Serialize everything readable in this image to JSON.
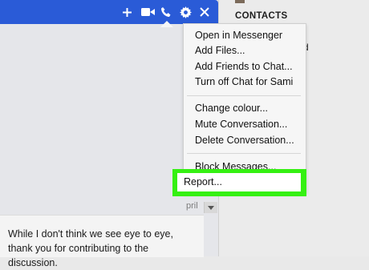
{
  "chat": {
    "header_color": "#2a5bd7",
    "icons": [
      "plus-icon",
      "video-camera-icon",
      "phone-icon",
      "gear-icon",
      "close-icon"
    ],
    "date_fragment": "pril",
    "message": "While I don't think we see eye to eye, thank you for contributing to the discussion."
  },
  "contacts": {
    "heading": "CONTACTS",
    "partial_text": "d"
  },
  "menu": {
    "groups": [
      [
        "Open in Messenger",
        "Add Files...",
        "Add Friends to Chat...",
        "Turn off Chat for Sami"
      ],
      [
        "Change colour...",
        "Mute Conversation...",
        "Delete Conversation..."
      ],
      [
        "Block Messages..."
      ]
    ],
    "report": "Report..."
  },
  "highlight_color": "#35f012"
}
